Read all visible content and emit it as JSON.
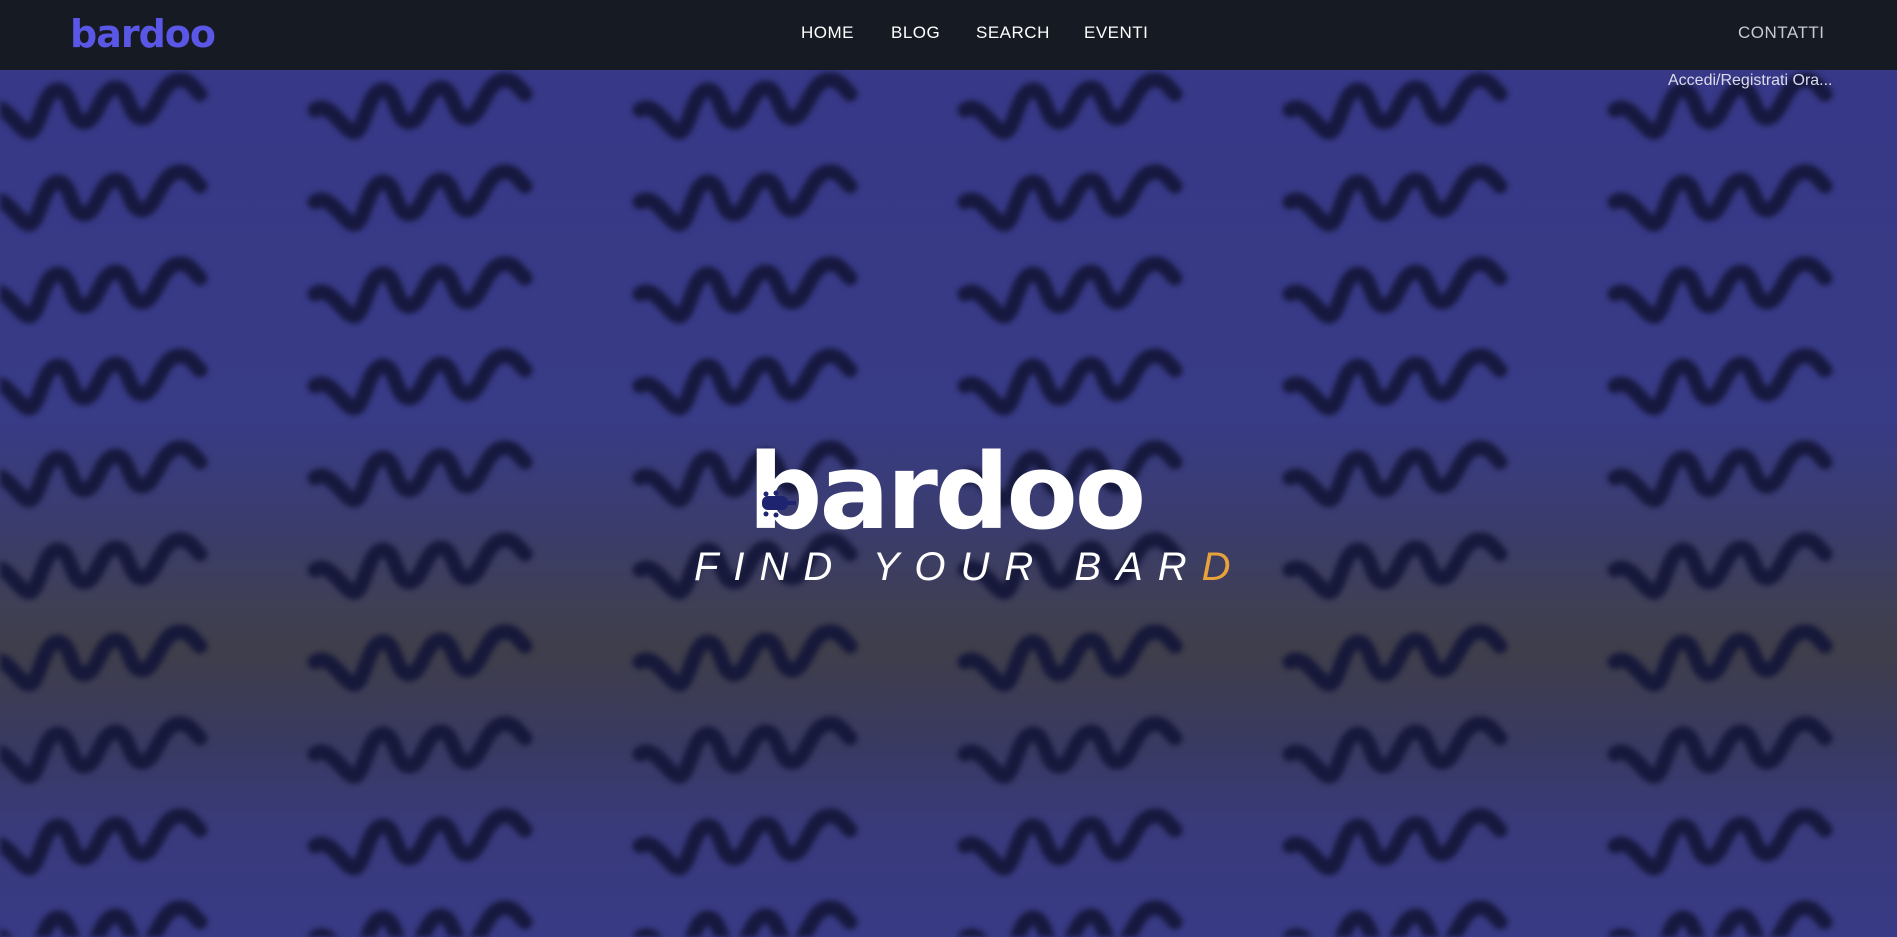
{
  "header": {
    "logo": "bardoo",
    "nav": {
      "home": "HOME",
      "blog": "BLOG",
      "search": "SEARCH",
      "eventi": "EVENTI"
    },
    "contatti": "CONTATTI"
  },
  "hero": {
    "login_link": "Accedi/Registrati Ora...",
    "logo": "bardoo",
    "tagline_main": "FIND YOUR BAR",
    "tagline_accent": "D"
  },
  "colors": {
    "brand": "#5b57e6",
    "accent": "#e8a23a",
    "topbar": "#161a22",
    "hero_blue": "#373887"
  },
  "icons": {
    "hero_logo_mark": "guitar-headstock-icon"
  }
}
